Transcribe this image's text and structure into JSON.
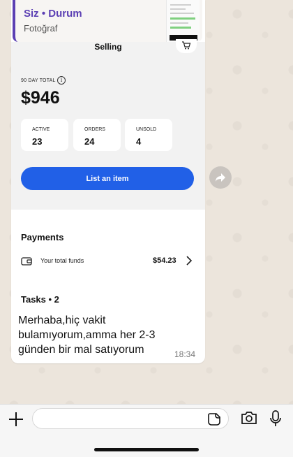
{
  "reply": {
    "name": "Siz • Durum",
    "type": "Fotoğraf"
  },
  "selling_screenshot": {
    "title": "Selling",
    "total_label": "90 DAY TOTAL",
    "info_icon": "i",
    "total_value": "$946",
    "stats": [
      {
        "label": "ACTIVE",
        "value": "23"
      },
      {
        "label": "ORDERS",
        "value": "24"
      },
      {
        "label": "UNSOLD",
        "value": "4"
      }
    ],
    "list_button": "List an item",
    "payments_title": "Payments",
    "funds_label": "Your total funds",
    "funds_amount": "$54.23",
    "tasks_title": "Tasks • 2",
    "accent_color": "#2160e7"
  },
  "message": {
    "text": "Merhaba,hiç vakit bulamıyorum,amma her 2-3 günden bir mal satıyorum",
    "time": "18:34"
  },
  "composer": {
    "placeholder": ""
  }
}
